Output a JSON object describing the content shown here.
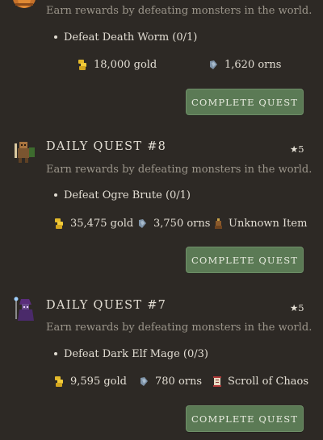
{
  "quests": [
    {
      "description": "Earn rewards by defeating monsters in the world.",
      "objective": "Defeat Death Worm (0/1)",
      "rewards": [
        {
          "icon": "gold-coins-icon",
          "text": "18,000 gold"
        },
        {
          "icon": "orns-icon",
          "text": "1,620 orns"
        }
      ],
      "button": "COMPLETE QUEST",
      "icon": "pumpkin-monster-icon"
    },
    {
      "title": "DAILY QUEST #8",
      "stars": "★5",
      "description": "Earn rewards by defeating monsters in the world.",
      "objective": "Defeat Ogre Brute (0/1)",
      "rewards": [
        {
          "icon": "gold-coins-icon",
          "text": "35,475 gold"
        },
        {
          "icon": "orns-icon",
          "text": "3,750 orns"
        },
        {
          "icon": "unknown-item-icon",
          "text": "Unknown Item"
        }
      ],
      "button": "COMPLETE QUEST",
      "icon": "ogre-brute-icon"
    },
    {
      "title": "DAILY QUEST #7",
      "stars": "★5",
      "description": "Earn rewards by defeating monsters in the world.",
      "objective": "Defeat Dark Elf Mage (0/3)",
      "rewards": [
        {
          "icon": "gold-coins-icon",
          "text": "9,595 gold"
        },
        {
          "icon": "orns-icon",
          "text": "780 orns"
        },
        {
          "icon": "scroll-icon",
          "text": "Scroll of Chaos"
        }
      ],
      "button": "COMPLETE QUEST",
      "icon": "dark-elf-mage-icon"
    }
  ]
}
